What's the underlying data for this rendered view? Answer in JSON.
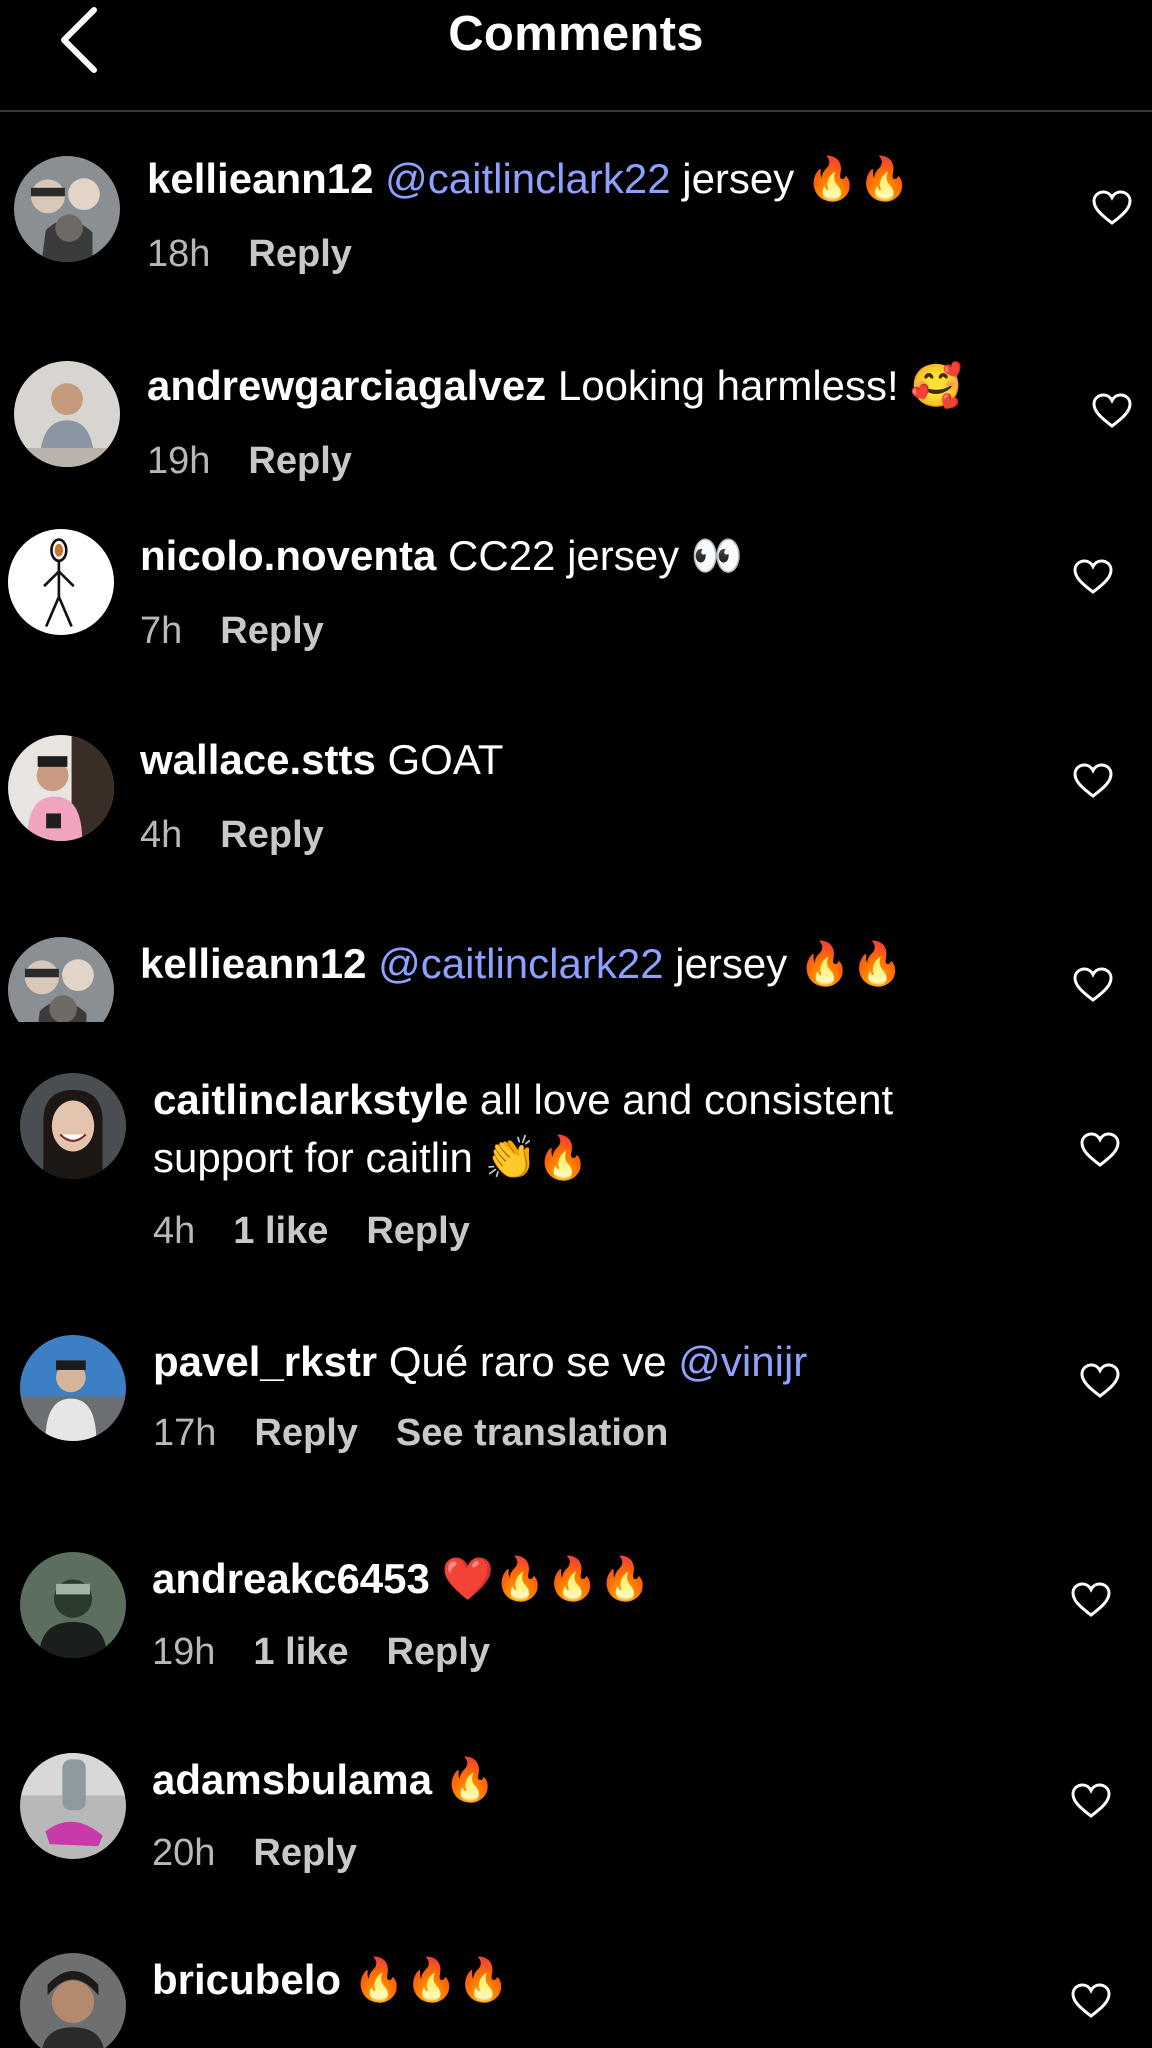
{
  "header": {
    "title": "Comments",
    "back_icon": "chevron-left-icon"
  },
  "colors": {
    "background": "#000000",
    "mention": "#8fa0ff",
    "meta": "#b8b8b8"
  },
  "comments": [
    {
      "username": "kellieann12",
      "mention": "@caitlinclark22",
      "text": " jersey 🔥🔥",
      "time": "18h",
      "reply": "Reply"
    },
    {
      "username": "andrewgarciagalvez",
      "text": " Looking harmless! 🥰",
      "time": "19h",
      "reply": "Reply"
    },
    {
      "username": "nicolo.noventa",
      "text": " CC22 jersey 👀",
      "time": "7h",
      "reply": "Reply"
    },
    {
      "username": "wallace.stts",
      "text": " GOAT",
      "time": "4h",
      "reply": "Reply"
    },
    {
      "username": "kellieann12",
      "mention": "@caitlinclark22",
      "text": " jersey 🔥🔥"
    },
    {
      "username": "caitlinclarkstyle",
      "text": " all love and consistent support for caitlin 👏🔥",
      "time": "4h",
      "likes": "1 like",
      "reply": "Reply"
    },
    {
      "username": "pavel_rkstr",
      "text": " Qué raro se ve ",
      "mention": "@vinijr",
      "time": "17h",
      "reply": "Reply",
      "translate": "See translation"
    },
    {
      "username": "andreakc6453",
      "text": " ❤️🔥🔥🔥",
      "time": "19h",
      "likes": "1 like",
      "reply": "Reply"
    },
    {
      "username": "adamsbulama",
      "text": " 🔥",
      "time": "20h",
      "reply": "Reply"
    },
    {
      "username": "bricubelo",
      "text": " 🔥🔥🔥"
    }
  ]
}
